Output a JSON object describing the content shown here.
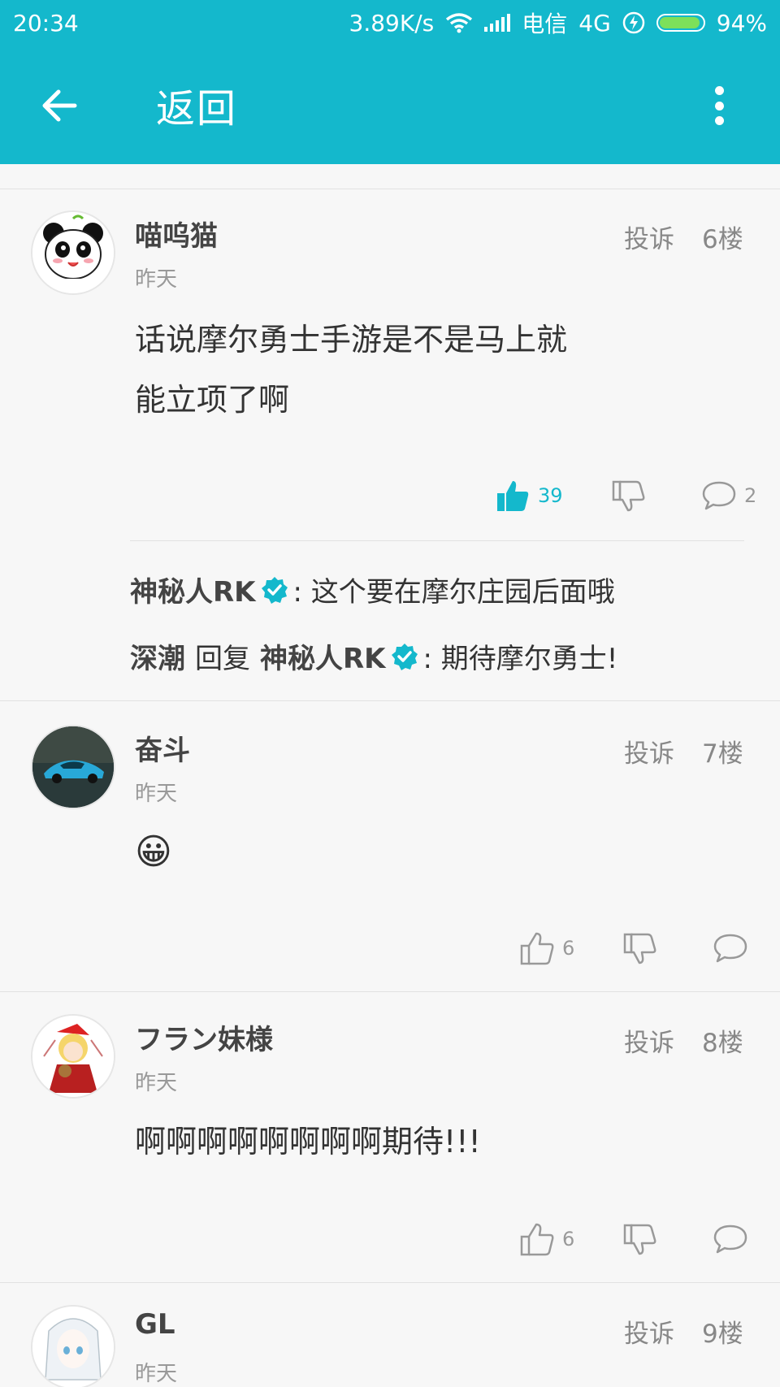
{
  "status_bar": {
    "time": "20:34",
    "speed": "3.89K/s",
    "carrier": "电信",
    "network": "4G",
    "battery": "94%",
    "battery_level": 0.94
  },
  "app_bar": {
    "title": "返回"
  },
  "colors": {
    "accent": "#14b8cc"
  },
  "posts": [
    {
      "username": "喵呜猫",
      "time": "昨天",
      "report": "投诉",
      "floor": "6楼",
      "content_lines": [
        "话说摩尔勇士手游是不是马上就",
        "能立项了啊"
      ],
      "likes": "39",
      "liked": true,
      "comments": "2",
      "replies": [
        {
          "author": "神秘人RK",
          "text": ": 这个要在摩尔庄园后面哦"
        },
        {
          "author": "深潮",
          "verb": "回复",
          "target": "神秘人RK",
          "text": ": 期待摩尔勇士!"
        }
      ]
    },
    {
      "username": "奋斗",
      "time": "昨天",
      "report": "投诉",
      "floor": "7楼",
      "emoji": "😀",
      "likes": "6"
    },
    {
      "username": "フラン妹様",
      "time": "昨天",
      "report": "投诉",
      "floor": "8楼",
      "content": "啊啊啊啊啊啊啊啊期待!!!",
      "likes": "6"
    },
    {
      "username": "GL",
      "time": "昨天",
      "report": "投诉",
      "floor": "9楼"
    }
  ]
}
